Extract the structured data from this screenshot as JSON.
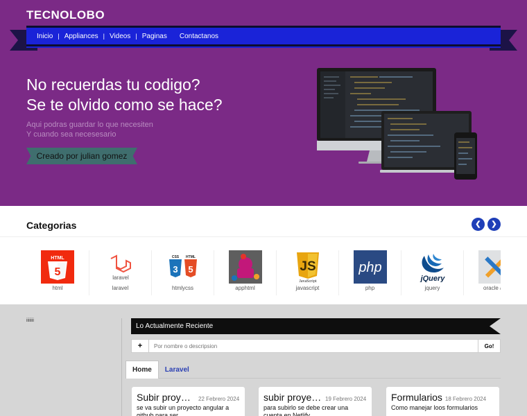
{
  "brand": "TECNOLOBO",
  "nav": [
    "Inicio",
    "Appliances",
    "Videos",
    "Paginas",
    "Contactanos"
  ],
  "hero": {
    "line1": "No recuerdas tu codigo?",
    "line2": "Se te olvido como se hace?",
    "sub1": "Aqui podras guardar lo que necesiten",
    "sub2": "Y cuando sea necesesario",
    "cta": "Creado por julian gomez"
  },
  "categories": {
    "title": "Categorias",
    "prev_icon": "chevron-left-icon",
    "next_icon": "chevron-right-icon",
    "items": [
      {
        "label": "html",
        "icon": "html5-logo-icon"
      },
      {
        "label": "laravel",
        "icon": "laravel-logo-icon"
      },
      {
        "label": "htmlycss",
        "icon": "css-html-logo-icon"
      },
      {
        "label": "apphtml",
        "icon": "app-html-logo-icon"
      },
      {
        "label": "javascript",
        "icon": "javascript-logo-icon"
      },
      {
        "label": "php",
        "icon": "php-logo-icon"
      },
      {
        "label": "jquery",
        "icon": "jquery-logo-icon"
      },
      {
        "label": "oracle ap",
        "icon": "pencil-ruler-icon"
      }
    ]
  },
  "sidebar_text": "iiiiiii",
  "recent": {
    "title": "Lo Actualmente Reciente",
    "search_placeholder": "Por nombre o descripsion",
    "plus": "+",
    "go": "Go!"
  },
  "tabs": [
    "Home",
    "Laravel"
  ],
  "cards": [
    {
      "title": "Subir proyecto",
      "date": "22 Febrero 2024",
      "desc": "se va subir un proyecto angular a github para ser"
    },
    {
      "title": "subir proyecto",
      "date": "19 Febrero 2024",
      "desc": "para subirlo se debe crear una cuenta en Netlify"
    },
    {
      "title": "Formularios",
      "date": "18 Febrero 2024",
      "desc": "Como manejar loos formularios"
    }
  ],
  "colors": {
    "hero_bg": "#7b2a86",
    "nav_bg": "#1a23d8",
    "cta_bg": "#3f6e6e",
    "arrow_bg": "#1f3fb8"
  }
}
